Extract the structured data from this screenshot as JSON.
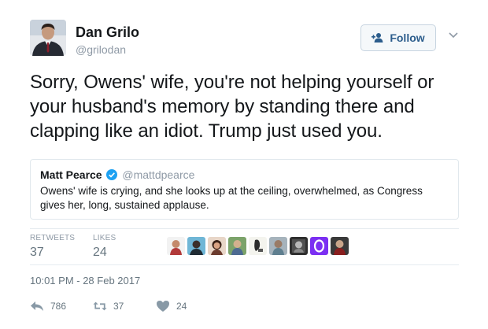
{
  "user": {
    "name": "Dan Grilo",
    "handle": "@grilodan"
  },
  "follow_button": {
    "label": "Follow",
    "icon": "add-user-icon"
  },
  "tweet": {
    "text": "Sorry, Owens' wife, you're not helping yourself or your husband's memory by standing there and clapping like an idiot. Trump just used you."
  },
  "quoted_tweet": {
    "name": "Matt Pearce",
    "handle": "@mattdpearce",
    "text": "Owens' wife is crying, and she looks up at the ceiling, overwhelmed, as Congress gives her, long, sustained applause."
  },
  "stats": {
    "retweets_label": "RETWEETS",
    "retweets_value": "37",
    "likes_label": "LIKES",
    "likes_value": "24"
  },
  "timestamp": "10:01 PM - 28 Feb 2017",
  "actions": {
    "reply_count": "786",
    "retweet_count": "37",
    "like_count": "24"
  },
  "colors": {
    "follow_text": "#2c5d8c",
    "verified_badge": "#1da1f2",
    "muted": "#8f9aa6"
  }
}
